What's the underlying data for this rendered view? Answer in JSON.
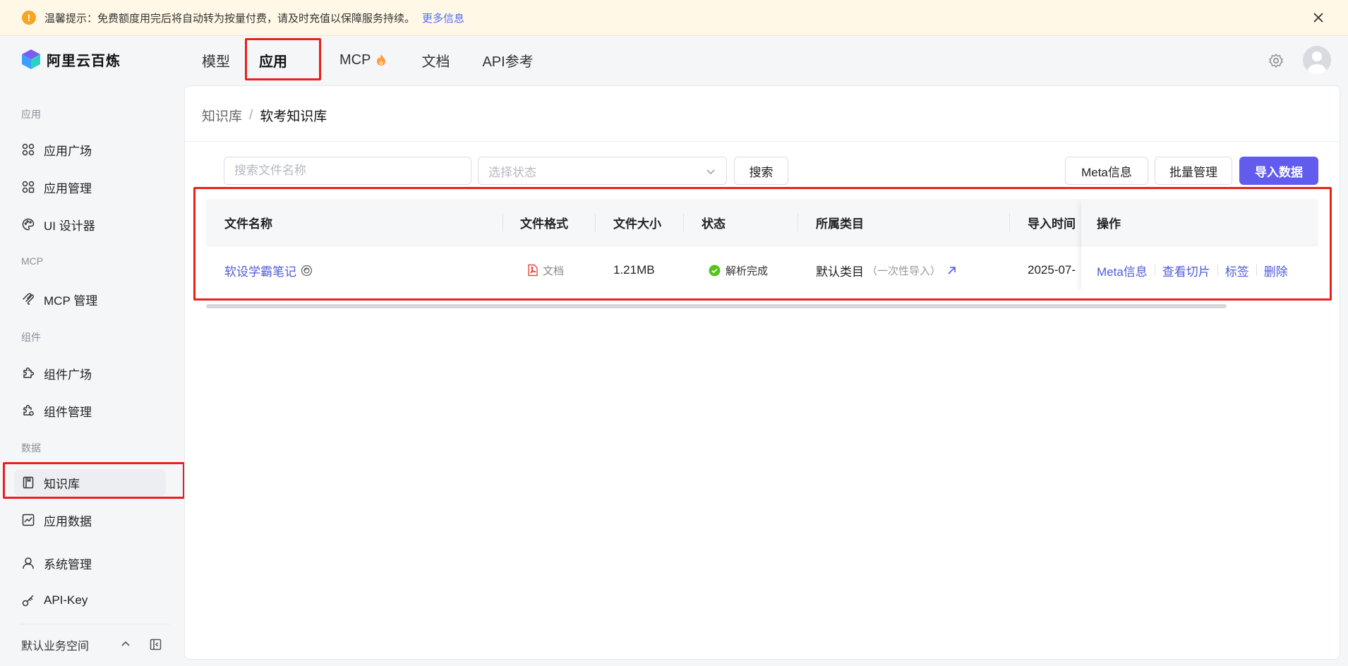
{
  "notice": {
    "icon": "warning-icon",
    "text": "温馨提示：免费额度用完后将自动转为按量付费，请及时充值以保障服务持续。",
    "more_link": "更多信息"
  },
  "logo": {
    "name": "阿里云百炼"
  },
  "nav": {
    "items": [
      {
        "label": "模型"
      },
      {
        "label": "应用"
      },
      {
        "label": "MCP"
      },
      {
        "label": "文档"
      },
      {
        "label": "API参考"
      }
    ]
  },
  "sidebar": {
    "sections": {
      "app": "应用",
      "mcp": "MCP",
      "component": "组件",
      "data": "数据"
    },
    "items": {
      "app_plaza": "应用广场",
      "app_manage": "应用管理",
      "ui_designer": "UI 设计器",
      "mcp_manage": "MCP 管理",
      "comp_plaza": "组件广场",
      "comp_manage": "组件管理",
      "knowledge": "知识库",
      "app_data": "应用数据",
      "sys_manage": "系统管理",
      "api_key": "API-Key"
    },
    "workspace": "默认业务空间"
  },
  "breadcrumb": {
    "parent": "知识库",
    "separator": "/",
    "current": "软考知识库"
  },
  "toolbar": {
    "search_placeholder": "搜索文件名称",
    "status_placeholder": "选择状态",
    "search_button": "搜索",
    "meta_button": "Meta信息",
    "batch_button": "批量管理",
    "import_button": "导入数据"
  },
  "table": {
    "columns": {
      "name": "文件名称",
      "format": "文件格式",
      "size": "文件大小",
      "status": "状态",
      "category": "所属类目",
      "import_time": "导入时间",
      "actions": "操作"
    },
    "rows": [
      {
        "name": "软设学霸笔记",
        "format": "文档",
        "size": "1.21MB",
        "status": "解析完成",
        "category": "默认类目",
        "category_sub": "（一次性导入）",
        "import_time": "2025-07-",
        "actions": {
          "meta": "Meta信息",
          "chunks": "查看切片",
          "tags": "标签",
          "delete": "删除"
        }
      }
    ]
  },
  "colors": {
    "accent": "#615ced",
    "link": "#4f5bd5",
    "highlight": "#e8221b",
    "success": "#52c41a",
    "pdf": "#e5483f",
    "notice_bg": "#fff8e6"
  }
}
